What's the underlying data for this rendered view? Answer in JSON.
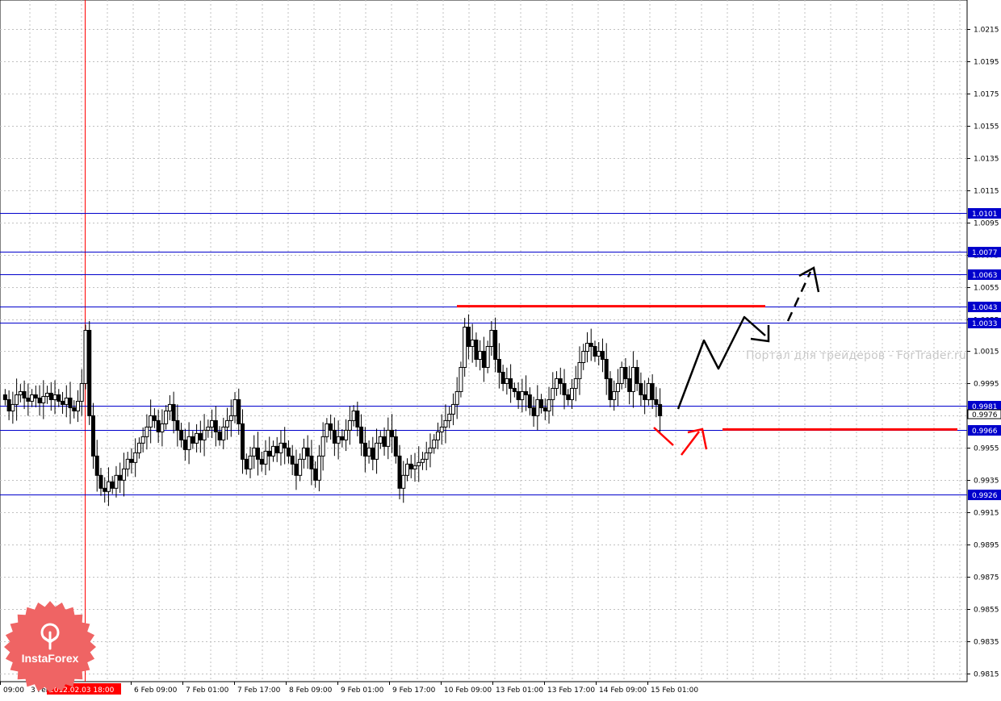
{
  "colors": {
    "background": "#ffffff",
    "grid": "#c0c0c0",
    "candle": "#000000",
    "level_line": "#0000cc",
    "level_label_bg": "#0000cc",
    "level_label_text": "#ffffff",
    "current_price_label_bg": "#ffffff",
    "cursor_line": "#ff0000",
    "cursor_label_bg": "#ff0000",
    "annotation_red": "#ff0000",
    "annotation_black": "#000000",
    "watermark": "#c8c8c8",
    "logo": "#ef6464"
  },
  "watermark": "Портал для трейдеров - ForTrader.ru",
  "logo": {
    "brand": "InstaForex",
    "icon": "tree-logo-icon"
  },
  "chart_data": {
    "type": "candlestick",
    "instrument": "",
    "y_axis": {
      "range": [
        0.9805,
        1.0228
      ],
      "ticks": [
        "1.0215",
        "1.0195",
        "1.0175",
        "1.0155",
        "1.0135",
        "1.0115",
        "1.0095",
        "1.0075",
        "1.0055",
        "1.0035",
        "1.0015",
        "0.9995",
        "0.9975",
        "0.9955",
        "0.9935",
        "0.9915",
        "0.9895",
        "0.9875",
        "0.9855",
        "0.9835",
        "0.9815"
      ],
      "tick_values": [
        1.0215,
        1.0195,
        1.0175,
        1.0155,
        1.0135,
        1.0115,
        1.0095,
        1.0075,
        1.0055,
        1.0035,
        1.0015,
        0.9995,
        0.9975,
        0.9955,
        0.9935,
        0.9915,
        0.9895,
        0.9875,
        0.9855,
        0.9835,
        0.9815
      ]
    },
    "x_axis": {
      "tick_labels": [
        "09:00",
        "3 Feb",
        "2012.02.03 18:00",
        "6 Feb 09:00",
        "7 Feb 01:00",
        "7 Feb 17:00",
        "8 Feb 09:00",
        "9 Feb 01:00",
        "9 Feb 17:00",
        "10 Feb 09:00",
        "13 Feb 01:00",
        "13 Feb 17:00",
        "14 Feb 09:00",
        "15 Feb 01:00"
      ],
      "cursor_label": "2012.02.03 18:00"
    },
    "grid": true,
    "levels": [
      {
        "value": 1.0101,
        "label": "1.0101"
      },
      {
        "value": 1.0077,
        "label": "1.0077"
      },
      {
        "value": 1.0063,
        "label": "1.0063"
      },
      {
        "value": 1.0043,
        "label": "1.0043"
      },
      {
        "value": 1.0033,
        "label": "1.0033"
      },
      {
        "value": 0.9981,
        "label": "0.9981"
      },
      {
        "value": 0.9966,
        "label": "0.9966"
      },
      {
        "value": 0.9926,
        "label": "0.9926"
      }
    ],
    "current_price": {
      "value": 0.9976,
      "label": "0.9976"
    },
    "close_series": [
      0.9985,
      0.9978,
      0.9982,
      0.9988,
      0.999,
      0.9986,
      0.9984,
      0.9988,
      0.9986,
      0.9983,
      0.9987,
      0.9989,
      0.9985,
      0.9988,
      0.9984,
      0.9982,
      0.9986,
      0.998,
      0.9978,
      0.9984,
      0.9995,
      1.0028,
      0.9975,
      0.995,
      0.9938,
      0.993,
      0.9928,
      0.9934,
      0.993,
      0.9938,
      0.9935,
      0.9942,
      0.9948,
      0.9946,
      0.9952,
      0.9958,
      0.9962,
      0.9968,
      0.9975,
      0.9972,
      0.9965,
      0.997,
      0.9978,
      0.9982,
      0.9972,
      0.9966,
      0.996,
      0.9954,
      0.9962,
      0.9958,
      0.9964,
      0.996,
      0.9966,
      0.9968,
      0.9972,
      0.9965,
      0.996,
      0.9968,
      0.9972,
      0.9975,
      0.9985,
      0.997,
      0.9948,
      0.9942,
      0.995,
      0.9955,
      0.9948,
      0.9945,
      0.9953,
      0.995,
      0.9956,
      0.9952,
      0.9958,
      0.9955,
      0.995,
      0.9945,
      0.9938,
      0.9948,
      0.9955,
      0.995,
      0.9942,
      0.9935,
      0.995,
      0.9962,
      0.997,
      0.9966,
      0.9958,
      0.9962,
      0.996,
      0.9966,
      0.9972,
      0.9978,
      0.9968,
      0.9958,
      0.995,
      0.9955,
      0.9948,
      0.9958,
      0.9962,
      0.9956,
      0.9966,
      0.9962,
      0.995,
      0.993,
      0.9938,
      0.9945,
      0.9942,
      0.9944,
      0.9946,
      0.9948,
      0.9952,
      0.9955,
      0.996,
      0.9965,
      0.9968,
      0.9972,
      0.9976,
      0.9982,
      0.999,
      1.0005,
      1.003,
      1.0018,
      1.0022,
      1.001,
      1.0015,
      1.0005,
      1.0018,
      1.0028,
      1.001,
      1.0002,
      0.9995,
      0.9998,
      0.9992,
      0.999,
      0.9985,
      0.999,
      0.9988,
      0.998,
      0.9975,
      0.9985,
      0.998,
      0.9978,
      0.9985,
      0.9992,
      0.9998,
      0.9995,
      0.9988,
      0.9985,
      0.9992,
      0.9998,
      1.0008,
      1.0015,
      1.002,
      1.0018,
      1.0012,
      1.0015,
      1.001,
      0.9998,
      0.9985,
      0.999,
      0.9995,
      1.0005,
      0.9998,
      0.999,
      1.0005,
      0.9995,
      0.9988,
      0.9985,
      0.9995,
      0.9985,
      0.9982,
      0.9975
    ]
  }
}
